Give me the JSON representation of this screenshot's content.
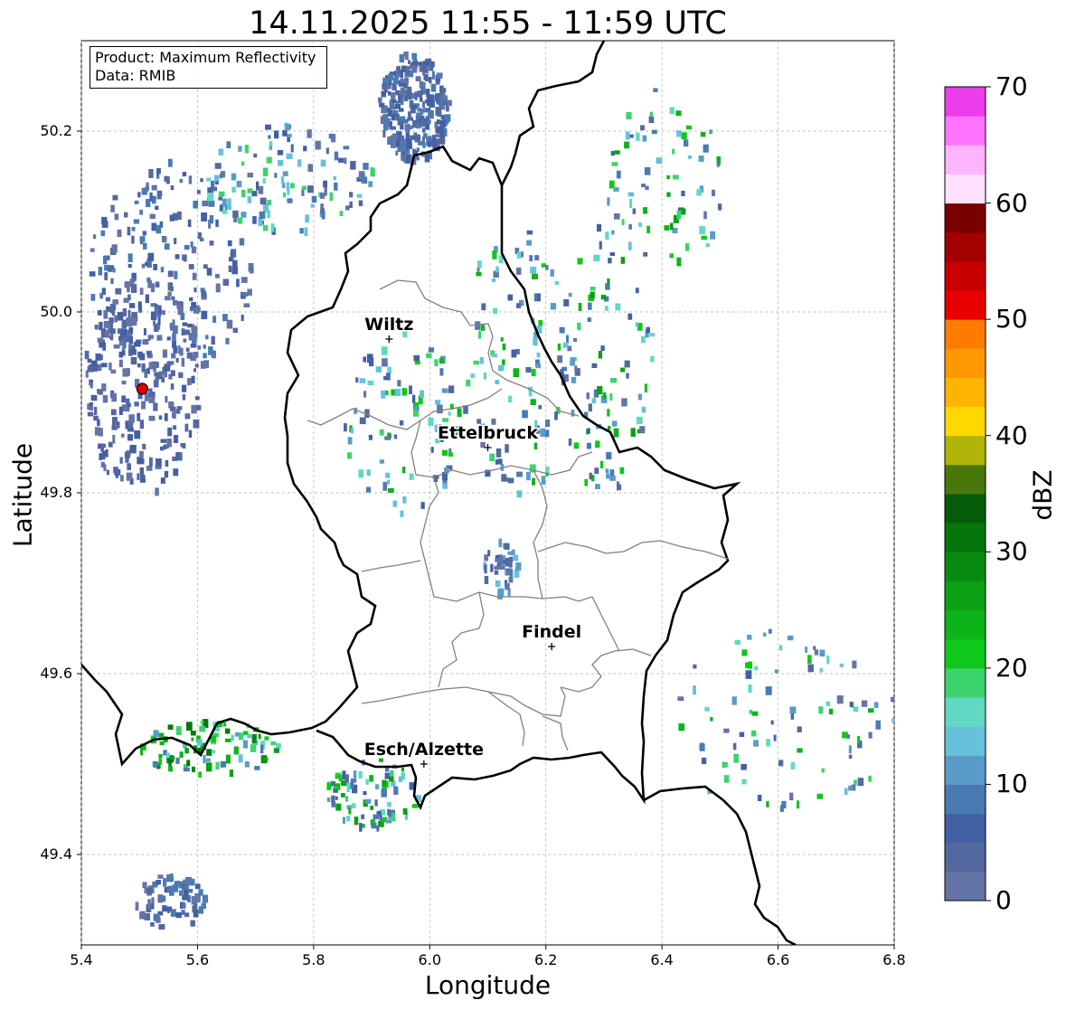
{
  "title": "14.11.2025 11:55 - 11:59 UTC",
  "info_box": {
    "product": "Product: Maximum Reflectivity",
    "data": "Data: RMIB"
  },
  "axes": {
    "xlabel": "Longitude",
    "ylabel": "Latitude",
    "xlim": [
      5.4,
      6.8
    ],
    "ylim": [
      49.3,
      50.3
    ],
    "xticks": [
      "5.4",
      "5.6",
      "5.8",
      "6.0",
      "6.2",
      "6.4",
      "6.6",
      "6.8"
    ],
    "yticks": [
      "49.4",
      "49.6",
      "49.8",
      "50.0",
      "50.2"
    ]
  },
  "colorbar": {
    "label": "dBZ",
    "range": [
      0,
      70
    ],
    "ticks": [
      "0",
      "10",
      "20",
      "30",
      "40",
      "50",
      "60",
      "70"
    ],
    "colors": [
      "#6474a6",
      "#5468a0",
      "#4460a4",
      "#4a7ab2",
      "#5a9cc8",
      "#66c2da",
      "#60d8c4",
      "#3cd46c",
      "#10c81c",
      "#0cb418",
      "#0ca014",
      "#088a10",
      "#06760c",
      "#055c08",
      "#48780a",
      "#b0b408",
      "#ffd800",
      "#ffb400",
      "#ff9800",
      "#ff7c00",
      "#e80000",
      "#c80000",
      "#a40000",
      "#780000",
      "#ffe0ff",
      "#ffb4ff",
      "#ff74ff",
      "#ec3cec"
    ]
  },
  "cities": [
    {
      "name": "Wiltz",
      "lon": 5.93,
      "lat": 49.97
    },
    {
      "name": "Ettelbruck",
      "lon": 6.1,
      "lat": 49.85
    },
    {
      "name": "Findel",
      "lon": 6.21,
      "lat": 49.63
    },
    {
      "name": "Esch/Alzette",
      "lon": 5.99,
      "lat": 49.5
    }
  ],
  "radar_site": {
    "lon": 5.505,
    "lat": 49.915
  }
}
